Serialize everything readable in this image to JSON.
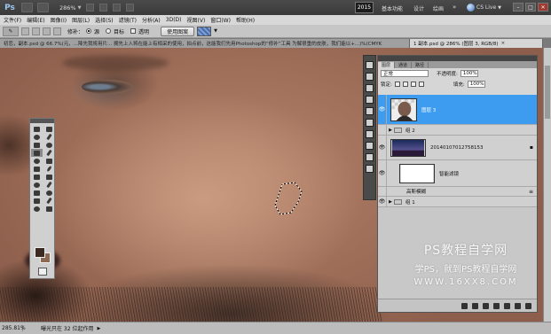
{
  "app": {
    "logo": "Ps",
    "zoom_select": "286%",
    "workspace_active": "2015",
    "workspaces": [
      "基本功能",
      "设计",
      "绘画"
    ],
    "more": "»",
    "cs_live": "CS Live"
  },
  "window_controls": {
    "minimize": "–",
    "restore": "□",
    "close": "✕"
  },
  "menu": [
    "文件(F)",
    "编辑(E)",
    "图像(I)",
    "图层(L)",
    "选择(S)",
    "滤镜(T)",
    "分析(A)",
    "3D(D)",
    "视图(V)",
    "窗口(W)",
    "帮助(H)"
  ],
  "options": {
    "radio_source_label": "源",
    "radio_target_label": "目标",
    "transparent_label": "透明",
    "use_pattern_label": "使用图案",
    "patch_label": "修补："
  },
  "tabs": [
    {
      "label": "初恋，副本.psd @ 66.7%(元，...降先我将用片... 拥先上入将在能上有相采的使用，拍点前，这能我们先用Photoshop的“修补”工具 为解很重的皮肤，我们能以+...)%(CMYK",
      "active": false
    },
    {
      "label": "1 副本.psd @ 286% (图层 3, RGB/8)",
      "active": true
    }
  ],
  "status": {
    "zoom": "285.81%",
    "message": "曝光只在 32 位起作用"
  },
  "layers_panel": {
    "tabs": [
      "图层",
      "通道",
      "路径"
    ],
    "blend_mode": "正常",
    "opacity_label": "不透明度:",
    "opacity_value": "100%",
    "lock_label": "锁定:",
    "fill_label": "填充:",
    "fill_value": "100%",
    "layers": [
      {
        "name": "图层 3",
        "visible": true,
        "selected": true,
        "kind": "layer"
      },
      {
        "name": "组 2",
        "visible": false,
        "selected": false,
        "kind": "group"
      },
      {
        "name": "20140107012758153",
        "visible": true,
        "selected": false,
        "kind": "smart"
      },
      {
        "name": "智能滤镜",
        "visible": true,
        "selected": false,
        "kind": "filter-mask"
      },
      {
        "name": "高斯模糊",
        "visible": false,
        "selected": false,
        "kind": "filter"
      },
      {
        "name": "组 1",
        "visible": true,
        "selected": false,
        "kind": "group"
      }
    ]
  },
  "watermark": {
    "line1": "PS教程自学网",
    "line2": "学PS，就到PS教程自学网",
    "line3": "WWW.16XX8.COM"
  },
  "colors": {
    "selection_highlight": "#3d9cf0",
    "foreground": "#3b2a22",
    "background": "#8a6a52"
  }
}
